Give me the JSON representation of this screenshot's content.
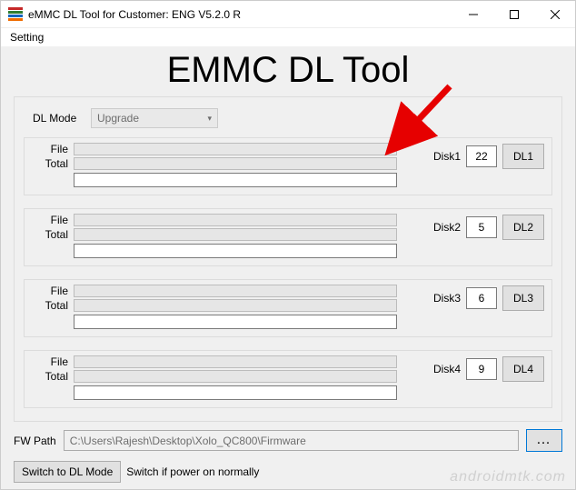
{
  "window": {
    "title": "eMMC DL Tool for Customer: ENG V5.2.0 R"
  },
  "menu": {
    "setting": "Setting"
  },
  "heading": "EMMC DL Tool",
  "dl_mode": {
    "label": "DL Mode",
    "value": "Upgrade"
  },
  "labels": {
    "file": "File",
    "total": "Total"
  },
  "disks": [
    {
      "name": "Disk1",
      "value": "22",
      "button": "DL1"
    },
    {
      "name": "Disk2",
      "value": "5",
      "button": "DL2"
    },
    {
      "name": "Disk3",
      "value": "6",
      "button": "DL3"
    },
    {
      "name": "Disk4",
      "value": "9",
      "button": "DL4"
    }
  ],
  "fw": {
    "label": "FW Path",
    "path": "C:\\Users\\Rajesh\\Desktop\\Xolo_QC800\\Firmware",
    "browse": "..."
  },
  "switch": {
    "button": "Switch to DL Mode",
    "hint": "Switch if power on normally"
  },
  "watermark": "androidmtk.com"
}
